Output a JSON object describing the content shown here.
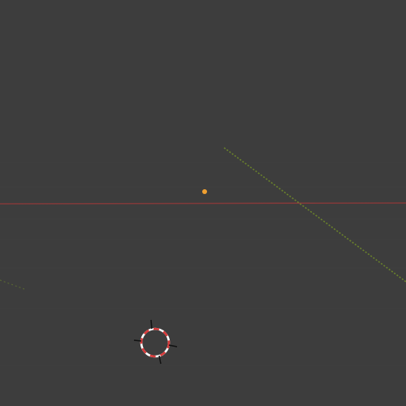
{
  "viewport": {
    "name": "3d-viewport",
    "background": "#3d3d3d",
    "grid_color": "#474747",
    "x_axis_color": "#8a3a3a",
    "y_axis_color": "#6f8a2a",
    "origin_color": "#f0a030",
    "cursor_colors": [
      "#ffffff",
      "#d83a3a"
    ]
  }
}
